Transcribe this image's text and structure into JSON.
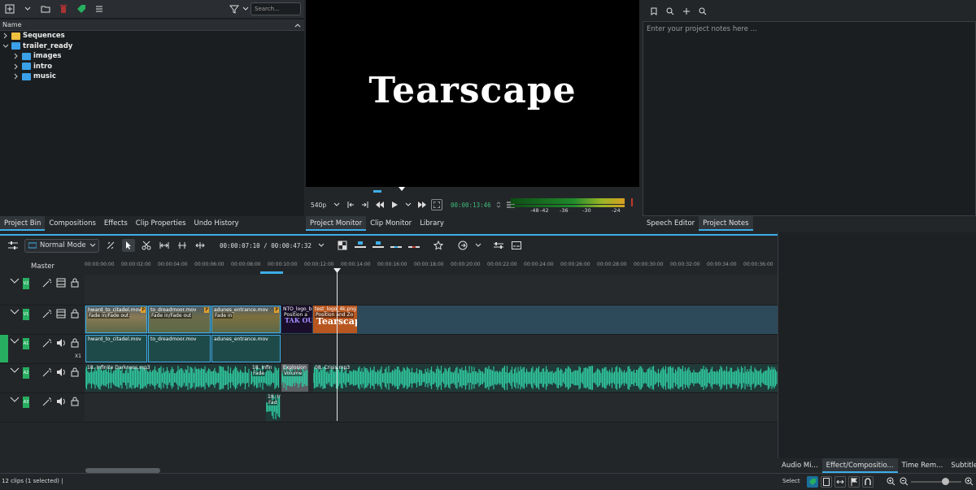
{
  "bin": {
    "search_placeholder": "Search...",
    "column_name": "Name",
    "tree": [
      {
        "label": "Sequences",
        "level": 0,
        "color": "#f0c040",
        "expanded": false
      },
      {
        "label": "trailer_ready",
        "level": 0,
        "color": "#3aa0e8",
        "expanded": true
      },
      {
        "label": "images",
        "level": 1,
        "color": "#3aa0e8",
        "expanded": false
      },
      {
        "label": "intro",
        "level": 1,
        "color": "#3aa0e8",
        "expanded": false
      },
      {
        "label": "music",
        "level": 1,
        "color": "#3aa0e8",
        "expanded": false
      }
    ]
  },
  "left_tabs": [
    "Project Bin",
    "Compositions",
    "Effects",
    "Clip Properties",
    "Undo History"
  ],
  "monitor": {
    "title_text": "Tearscape",
    "zoom": "540p",
    "timecode": "00:00:13:46",
    "vu_labels": [
      "-48",
      "-42",
      "-36",
      "-30",
      "-24"
    ]
  },
  "mid_tabs": [
    "Project Monitor",
    "Clip Monitor",
    "Library"
  ],
  "notes": {
    "placeholder": "Enter your project notes here ..."
  },
  "right_tabs": [
    "Speech Editor",
    "Project Notes"
  ],
  "timeline": {
    "mode": "Normal Mode",
    "timecode": "00:00:07:10 / 00:00:47:32",
    "master_label": "Master",
    "x1_label": "X1",
    "track_badges": [
      "V2",
      "V1",
      "A1",
      "A2",
      "A3"
    ],
    "ruler_labels": [
      "00:00:00:00",
      "00:00:02:00",
      "00:00:04:00",
      "00:00:06:00",
      "00:00:08:00",
      "00:00:10:00",
      "00:00:12:00",
      "00:00:14:00",
      "00:00:16:00",
      "00:00:18:00",
      "00:00:20:00",
      "00:00:22:00",
      "00:00:24:00",
      "00:00:26:00",
      "00:00:28:00",
      "00:00:30:00",
      "00:00:32:00",
      "00:00:34:00",
      "00:00:36:00"
    ],
    "v1_clips": [
      {
        "name": "hward_to_citadel.mov",
        "effect": "Fade in/Fade out",
        "badge": "P"
      },
      {
        "name": "to_dreadmoor.mov",
        "effect": "Fade in/Fade out",
        "badge": "P"
      },
      {
        "name": "adunes_entrance.mov",
        "effect": "Fade in",
        "badge": "P"
      },
      {
        "name": "NTO_logo_b",
        "effect": "Position a",
        "art": "TAK OUT"
      },
      {
        "name": "test_logo_4k.png",
        "effect": "Position and Zo",
        "art": "Tearscap"
      }
    ],
    "a1_clips": [
      "hward_to_citadel.mov",
      "to_dreadmoor.mov",
      "adunes_entrance.mov"
    ],
    "a2_clips": [
      {
        "name": "18. Infinite Darkness.mp3"
      },
      {
        "name": "18. Infin",
        "effect": "Fade"
      },
      {
        "name": "Explosion",
        "effect": "Volume"
      },
      {
        "name": "08. Crisis.mp3"
      }
    ],
    "a3_clips": [
      {
        "name": "18. In",
        "effect": "Fad"
      }
    ]
  },
  "right_bottom_tabs": [
    "Audio Mi...",
    "Effect/Compositio...",
    "Time Rem...",
    "Subtitles"
  ],
  "status": {
    "clips": "12 clips (1 selected) |",
    "select_label": "Select"
  },
  "colors": {
    "accent": "#3daee9",
    "track_badge": "#27ae60",
    "audio_wave": "#2fc59e",
    "video_clip": "#3a5560",
    "selected_border": "#3daee9"
  }
}
